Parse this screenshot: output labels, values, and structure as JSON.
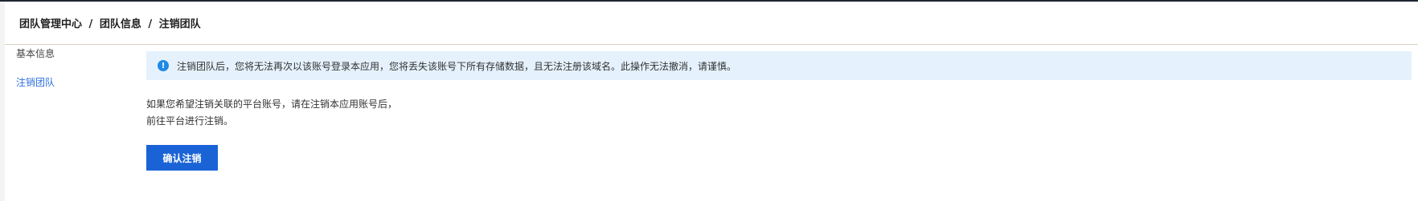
{
  "breadcrumb": {
    "items": [
      "团队管理中心",
      "团队信息",
      "注销团队"
    ],
    "separator": "/"
  },
  "sidebar": {
    "items": [
      {
        "label": "基本信息",
        "active": false
      },
      {
        "label": "注销团队",
        "active": true
      }
    ]
  },
  "alert": {
    "icon": "info-icon",
    "text": "注销团队后，您将无法再次以该账号登录本应用，您将丢失该账号下所有存储数据，且无法注册该域名。此操作无法撤消，请谨慎。"
  },
  "description": {
    "line1": "如果您希望注销关联的平台账号，请在注销本应用账号后，",
    "line2": "前往平台进行注销。"
  },
  "confirm_button": {
    "label": "确认注销"
  },
  "colors": {
    "accent": "#1a63d6",
    "alert_bg": "#e5f2fd",
    "alert_icon": "#1f8ae6",
    "active_link": "#2f6fe0"
  }
}
